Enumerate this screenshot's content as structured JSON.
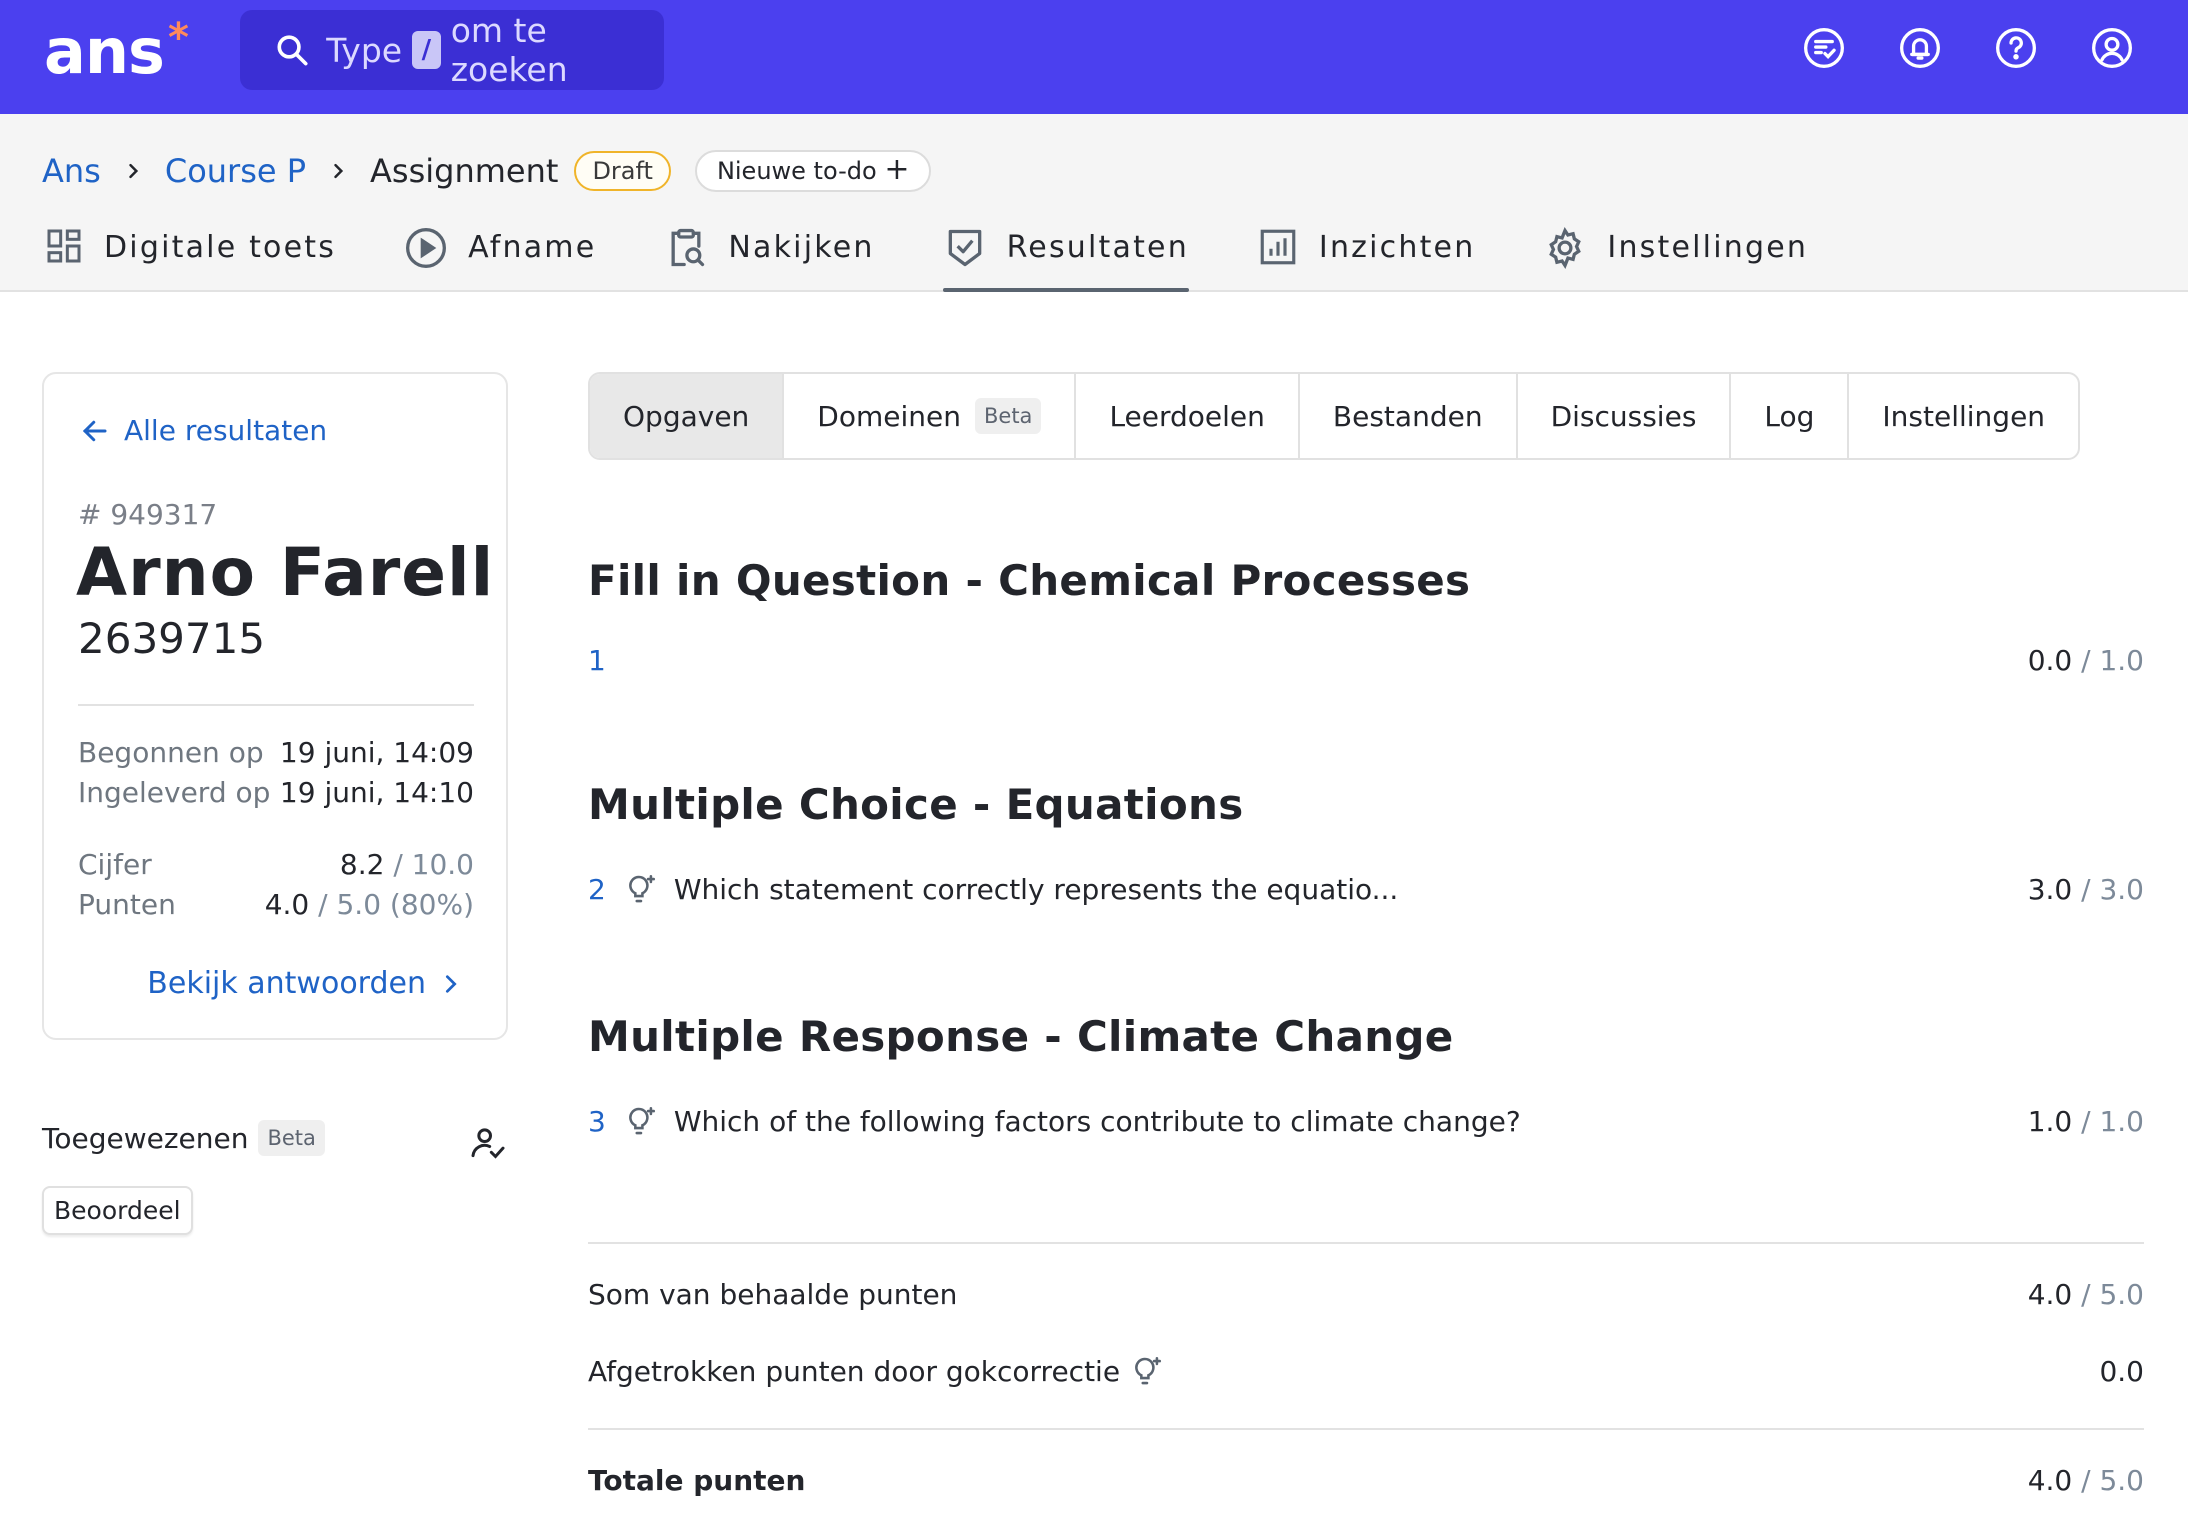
{
  "app": {
    "logo": "ans",
    "logo_star": "*"
  },
  "search": {
    "prefix": "Type",
    "key": "/",
    "suffix": "om te zoeken"
  },
  "top_icons": [
    "todo-list-icon",
    "bell-icon",
    "help-icon",
    "account-icon"
  ],
  "breadcrumb": {
    "items": [
      "Ans",
      "Course P"
    ],
    "current": "Assignment",
    "badge": "Draft",
    "new_todo": "Nieuwe to-do"
  },
  "tabs": [
    {
      "label": "Digitale toets",
      "icon": "dashboard-icon"
    },
    {
      "label": "Afname",
      "icon": "play-icon"
    },
    {
      "label": "Nakijken",
      "icon": "clipboard-search-icon"
    },
    {
      "label": "Resultaten",
      "icon": "shield-check-icon",
      "active": true
    },
    {
      "label": "Inzichten",
      "icon": "bar-chart-icon"
    },
    {
      "label": "Instellingen",
      "icon": "gear-icon"
    }
  ],
  "card": {
    "back": "Alle resultaten",
    "id": "# 949317",
    "name": "Arno Farell",
    "student_number": "2639715",
    "started_label": "Begonnen op",
    "started_value": "19 juni, 14:09",
    "submitted_label": "Ingeleverd op",
    "submitted_value": "19 juni, 14:10",
    "grade_label": "Cijfer",
    "grade_value": "8.2",
    "grade_max": " / 10.0",
    "points_label": "Punten",
    "points_value": "4.0",
    "points_max": " / 5.0 (80%)",
    "view_answers": "Bekijk antwoorden"
  },
  "assignees": {
    "title": "Toegewezenen",
    "badge": "Beta",
    "chip": "Beoordeel"
  },
  "subtabs": [
    "Opgaven",
    "Domeinen",
    "Leerdoelen",
    "Bestanden",
    "Discussies",
    "Log",
    "Instellingen"
  ],
  "subtab_badge": "Beta",
  "sections": [
    {
      "title": "Fill in Question - Chemical Processes",
      "questions": [
        {
          "num": "1",
          "text": "",
          "score": "0.0",
          "max": " / 1.0"
        }
      ]
    },
    {
      "title": "Multiple Choice - Equations",
      "questions": [
        {
          "num": "2",
          "text": "Which statement correctly represents the equatio...",
          "score": "3.0",
          "max": " / 3.0"
        }
      ]
    },
    {
      "title": "Multiple Response - Climate Change",
      "questions": [
        {
          "num": "3",
          "text": "Which of the following factors contribute to climate change?",
          "score": "1.0",
          "max": " / 1.0"
        }
      ]
    }
  ],
  "summary": {
    "sum_label": "Som van behaalde punten",
    "sum_value": "4.0",
    "sum_max": " / 5.0",
    "deducted_label": "Afgetrokken punten door gokcorrectie",
    "deducted_value": "0.0",
    "total_label": "Totale punten",
    "total_value": "4.0",
    "total_max": " / 5.0"
  },
  "colors": {
    "brand": "#4b40ef",
    "link": "#1f63c6",
    "draft_border": "#f0b429"
  }
}
